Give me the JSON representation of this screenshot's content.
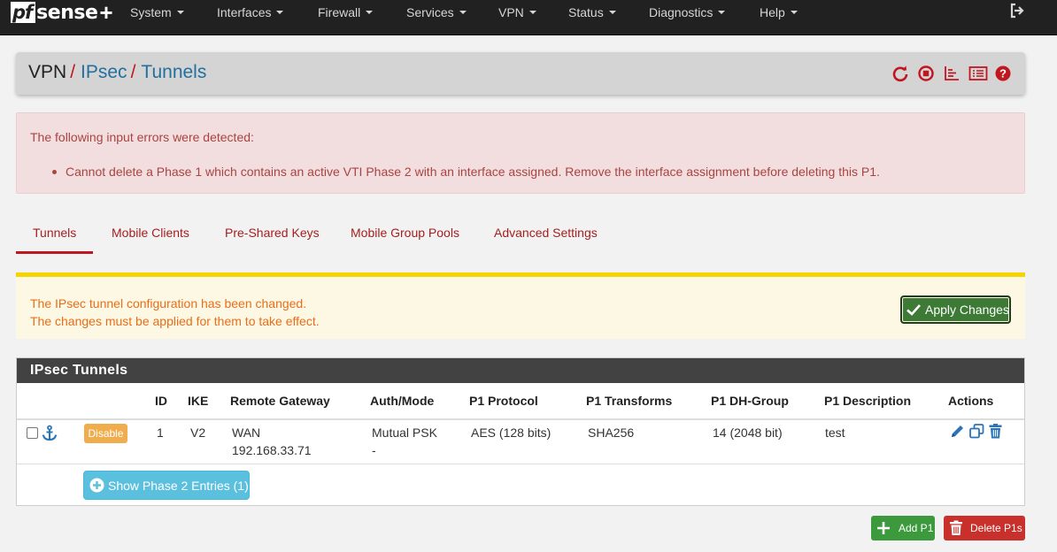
{
  "brand": {
    "logo_pf": "pf",
    "logo_sense": "sense",
    "logo_plus": "+"
  },
  "nav": {
    "items": [
      {
        "label": "System"
      },
      {
        "label": "Interfaces"
      },
      {
        "label": "Firewall"
      },
      {
        "label": "Services"
      },
      {
        "label": "VPN"
      },
      {
        "label": "Status"
      },
      {
        "label": "Diagnostics"
      },
      {
        "label": "Help"
      }
    ],
    "logout_icon": "logout-icon"
  },
  "breadcrumb": {
    "root": "VPN",
    "sep": "/",
    "level1": "IPsec",
    "level2": "Tunnels"
  },
  "header_icons": [
    "restart-icon",
    "stop-icon",
    "log-icon",
    "list-icon",
    "help-icon"
  ],
  "errors": {
    "title": "The following input errors were detected:",
    "items": [
      "Cannot delete a Phase 1 which contains an active VTI Phase 2 with an interface assigned. Remove the interface assignment before deleting this P1."
    ]
  },
  "tabs": [
    {
      "label": "Tunnels",
      "active": true
    },
    {
      "label": "Mobile Clients"
    },
    {
      "label": "Pre-Shared Keys"
    },
    {
      "label": "Mobile Group Pools"
    },
    {
      "label": "Advanced Settings"
    }
  ],
  "notice": {
    "line1": "The IPsec tunnel configuration has been changed.",
    "line2": "The changes must be applied for them to take effect.",
    "apply_label": "Apply Changes"
  },
  "panel": {
    "title": "IPsec Tunnels",
    "columns": [
      "ID",
      "IKE",
      "Remote Gateway",
      "Auth/Mode",
      "P1 Protocol",
      "P1 Transforms",
      "P1 DH-Group",
      "P1 Description",
      "Actions"
    ],
    "rows": [
      {
        "disable_label": "Disable",
        "id": "1",
        "ike": "V2",
        "gateway_iface": "WAN",
        "gateway_ip": "192.168.33.71",
        "auth": "Mutual PSK",
        "mode": "-",
        "protocol": "AES (128 bits)",
        "transforms": "SHA256",
        "dhgroup": "14 (2048 bit)",
        "description": "test"
      }
    ],
    "show_p2_label": "Show Phase 2 Entries (1)"
  },
  "footer": {
    "add_label": "Add P1",
    "delete_label": "Delete P1s"
  },
  "colors": {
    "navbar": "#212121",
    "accent_red": "#c0161f",
    "link_blue": "#23709e",
    "success": "#3c9a3c",
    "danger": "#c9302c",
    "info": "#5bc0de",
    "warning": "#f0ad4e"
  }
}
